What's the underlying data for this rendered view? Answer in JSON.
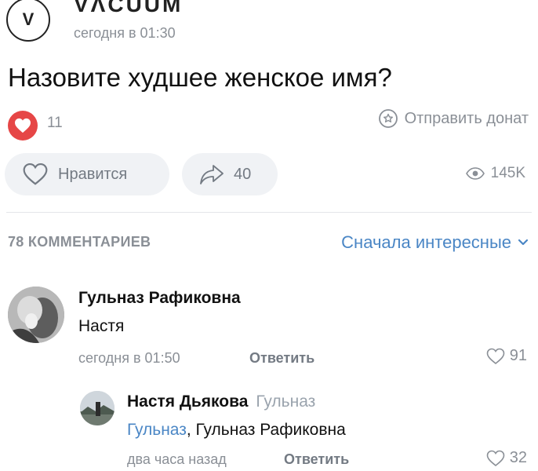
{
  "post": {
    "group_avatar_letter": "V",
    "group_name": "VΛCUUM",
    "time": "сегодня в 01:30",
    "title": "Назовите худшее женское имя?",
    "like_count": "11",
    "donate_label": "Отправить донат",
    "like_button_label": "Нравится",
    "share_count": "40",
    "views": "145K"
  },
  "comments_header": {
    "count_label": "78 КОММЕНТАРИЕВ",
    "sort_label": "Сначала интересные"
  },
  "comments": [
    {
      "author": "Гульназ Рафиковна",
      "text": "Настя",
      "time": "сегодня в 01:50",
      "reply_label": "Ответить",
      "likes": "91"
    },
    {
      "author": "Настя Дьякова",
      "reply_to_grey": "Гульназ",
      "reply_to_link": "Гульназ",
      "text": ", Гульназ Рафиковна",
      "time": "два часа назад",
      "reply_label": "Ответить",
      "likes": "32"
    }
  ],
  "colors": {
    "accent": "#4a86c5",
    "like_red": "#e64646",
    "muted": "#8a8f96"
  }
}
